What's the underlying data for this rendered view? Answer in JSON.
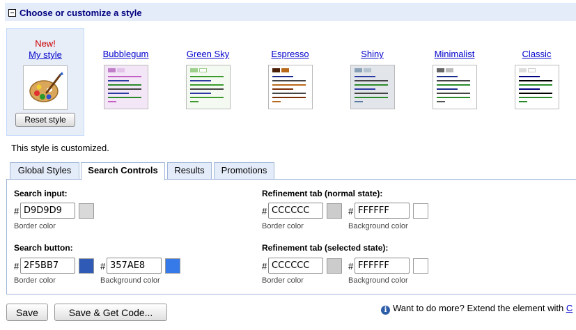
{
  "header": {
    "title": "Choose or customize a style"
  },
  "styles": [
    {
      "name": "My style",
      "badge": "New!",
      "selected": true
    },
    {
      "name": "Bubblegum",
      "accent": "#c45fc6",
      "bg": "#f3e6f6",
      "tab1": "#c27fc9",
      "tab2": "#e3c3ea"
    },
    {
      "name": "Green Sky",
      "accent": "#3c9a2c",
      "bg": "#f4faf2",
      "tab1": "#9ecf8c",
      "tab2": "#ffffff"
    },
    {
      "name": "Espresso",
      "accent": "#7a2f05",
      "bg": "#ffffff",
      "tab1": "#4a2108",
      "tab2": "#b8691a"
    },
    {
      "name": "Shiny",
      "accent": "#5a7aa0",
      "bg": "#e2e6ea",
      "tab1": "#8aa0b7",
      "tab2": "#b5c3d0"
    },
    {
      "name": "Minimalist",
      "accent": "#555555",
      "bg": "#ffffff",
      "tab1": "#666666",
      "tab2": "#bbbbbb"
    },
    {
      "name": "Classic",
      "accent": "#000080",
      "bg": "#ffffff",
      "tab1": "#dddddd",
      "tab2": "#ffffff"
    }
  ],
  "reset_label": "Reset style",
  "customized_text": "This style is customized.",
  "tabs": [
    "Global Styles",
    "Search Controls",
    "Results",
    "Promotions"
  ],
  "active_tab": "Search Controls",
  "search_input": {
    "title": "Search input:",
    "border": {
      "value": "D9D9D9",
      "color": "#D9D9D9",
      "label": "Border color"
    }
  },
  "search_button": {
    "title": "Search button:",
    "border": {
      "value": "2F5BB7",
      "color": "#2F5BB7",
      "label": "Border color"
    },
    "background": {
      "value": "357AE8",
      "color": "#357AE8",
      "label": "Background color"
    }
  },
  "refinement_normal": {
    "title": "Refinement tab (normal state):",
    "border": {
      "value": "CCCCCC",
      "color": "#CCCCCC",
      "label": "Border color"
    },
    "background": {
      "value": "FFFFFF",
      "color": "#FFFFFF",
      "label": "Background color"
    }
  },
  "refinement_selected": {
    "title": "Refinement tab (selected state):",
    "border": {
      "value": "CCCCCC",
      "color": "#CCCCCC",
      "label": "Border color"
    },
    "background": {
      "value": "FFFFFF",
      "color": "#FFFFFF",
      "label": "Background color"
    }
  },
  "hash": "#",
  "buttons": {
    "save": "Save",
    "save_code": "Save & Get Code..."
  },
  "info": {
    "text": "Want to do more? Extend the element with ",
    "link": "C"
  }
}
